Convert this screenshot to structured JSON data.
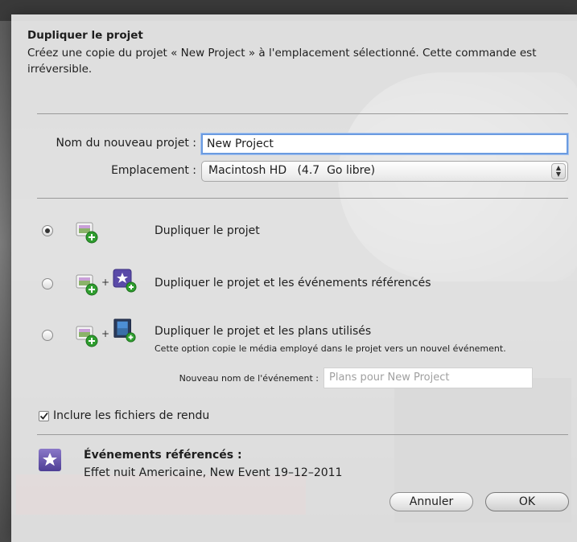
{
  "dialog": {
    "title": "Dupliquer le projet",
    "description": "Créez une copie du projet « New Project » à l'emplacement sélectionné. Cette commande est irréversible."
  },
  "form": {
    "name_label": "Nom du nouveau projet :",
    "name_value": "New Project",
    "location_label": "Emplacement :",
    "location_value": "Macintosh HD   (4.7  Go libre)"
  },
  "options": [
    {
      "label": "Dupliquer le projet",
      "selected": true
    },
    {
      "label": "Dupliquer le projet et les événements référencés",
      "selected": false
    },
    {
      "label": "Dupliquer le projet et les plans utilisés",
      "selected": false,
      "note": "Cette option copie le média employé dans le projet vers un nouvel événement."
    }
  ],
  "event_name": {
    "label": "Nouveau nom de l'événement :",
    "placeholder": "Plans pour New Project"
  },
  "include_render": {
    "label": "Inclure les fichiers de rendu",
    "checked": true
  },
  "referenced_events": {
    "title": "Événements référencés :",
    "value": "Effet nuit Americaine, New Event 19–12–2011"
  },
  "buttons": {
    "cancel": "Annuler",
    "ok": "OK"
  },
  "icons": {
    "project": "project-film-add-icon",
    "events": "event-star-add-icon",
    "clips": "clips-film-add-icon"
  },
  "colors": {
    "accent": "#6b9be0",
    "sheet": "#ececec",
    "event_icon": "#5a4aa8",
    "add_badge": "#2f9e2f"
  }
}
